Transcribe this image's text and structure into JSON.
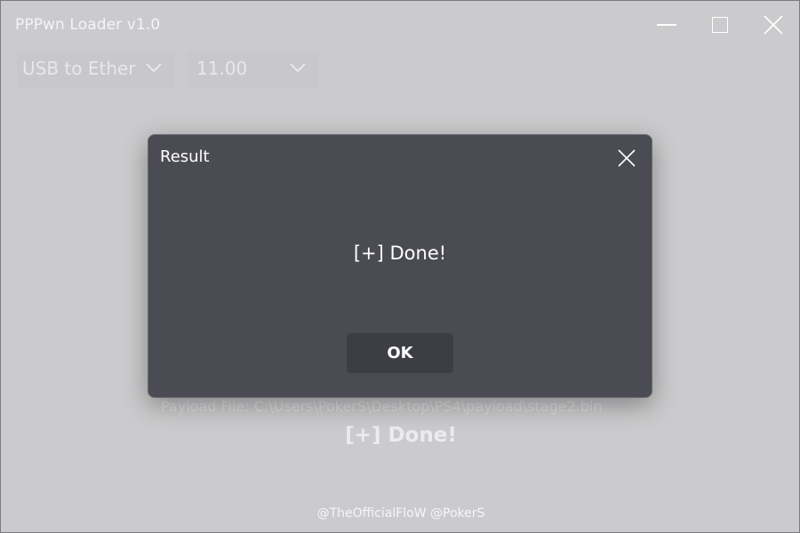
{
  "window": {
    "title": "PPPwn Loader v1.0"
  },
  "controls": {
    "connection": {
      "selected": "USB to Ether"
    },
    "firmware": {
      "selected": "11.00"
    }
  },
  "status": {
    "payload_file": "Payload File: C:\\Users\\PokerS\\Desktop\\PS4\\payload\\stage2.bin",
    "result": "[+] Done!"
  },
  "footer": {
    "credits": "@TheOfficialFloW @PokerS"
  },
  "dialog": {
    "title": "Result",
    "message": "[+] Done!",
    "ok_label": "OK"
  },
  "icons": {
    "minimize": "minimize-icon",
    "maximize": "maximize-icon",
    "close": "close-icon",
    "dropdown": "chevron-down-icon"
  },
  "colors": {
    "window_bg": "#cbcbcd",
    "dialog_bg": "#4b4c53",
    "button_bg": "#3d3e45"
  }
}
